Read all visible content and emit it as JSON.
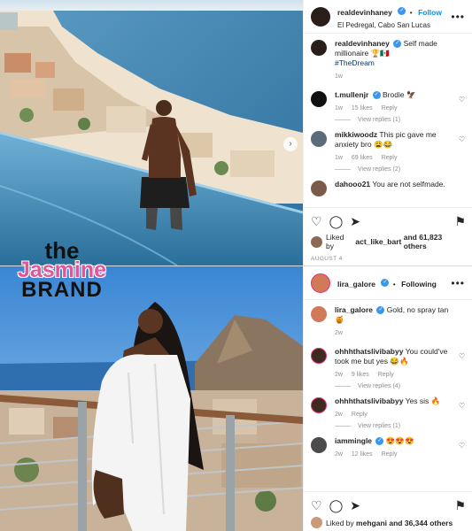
{
  "watermark": {
    "line1": "the",
    "line2": "Jasmine",
    "line3": "BRAND"
  },
  "posts": [
    {
      "username": "realdevinhaney",
      "follow_label": "Follow",
      "location": "El Pedregal, Cabo San Lucas",
      "caption_user": "realdevinhaney",
      "caption_text": "Self made millionaire 🏆🇲🇽",
      "hashtag": "#TheDream",
      "caption_time": "1w",
      "comments": [
        {
          "user": "t.mullenjr",
          "text": "Brodie 🦅",
          "time": "1w",
          "likes": "15 likes",
          "reply": "Reply",
          "view_replies": "View replies (1)"
        },
        {
          "user": "mikkiwoodz",
          "text": "This pic gave me anxiety bro 😩😂",
          "time": "1w",
          "likes": "69 likes",
          "reply": "Reply",
          "view_replies": "View replies (2)"
        },
        {
          "user": "dahooo21",
          "text": "You are not selfmade."
        }
      ],
      "liked_by_prefix": "Liked by",
      "liked_by_user": "act_like_bart",
      "liked_by_suffix": "and 61,823 others",
      "date": "AUGUST 4"
    },
    {
      "username": "lira_galore",
      "follow_label": "Following",
      "caption_user": "lira_galore",
      "caption_text": "Gold, no spray tan 🍯",
      "caption_time": "2w",
      "comments": [
        {
          "user": "ohhhthatslivibabyy",
          "text": "You could've took me but yes 😂🔥",
          "time": "2w",
          "likes": "9 likes",
          "reply": "Reply",
          "view_replies": "View replies (4)"
        },
        {
          "user": "ohhhthatslivibabyy",
          "text": "Yes sis 🔥",
          "time": "2w",
          "reply": "Reply",
          "view_replies": "View replies (1)"
        },
        {
          "user": "iammingle",
          "text": "😍😍😍",
          "time": "2w",
          "likes": "12 likes",
          "reply": "Reply"
        }
      ],
      "liked_by_prefix": "Liked by",
      "liked_by_user": "mehgani",
      "liked_by_suffix": "and 36,344 others"
    }
  ]
}
